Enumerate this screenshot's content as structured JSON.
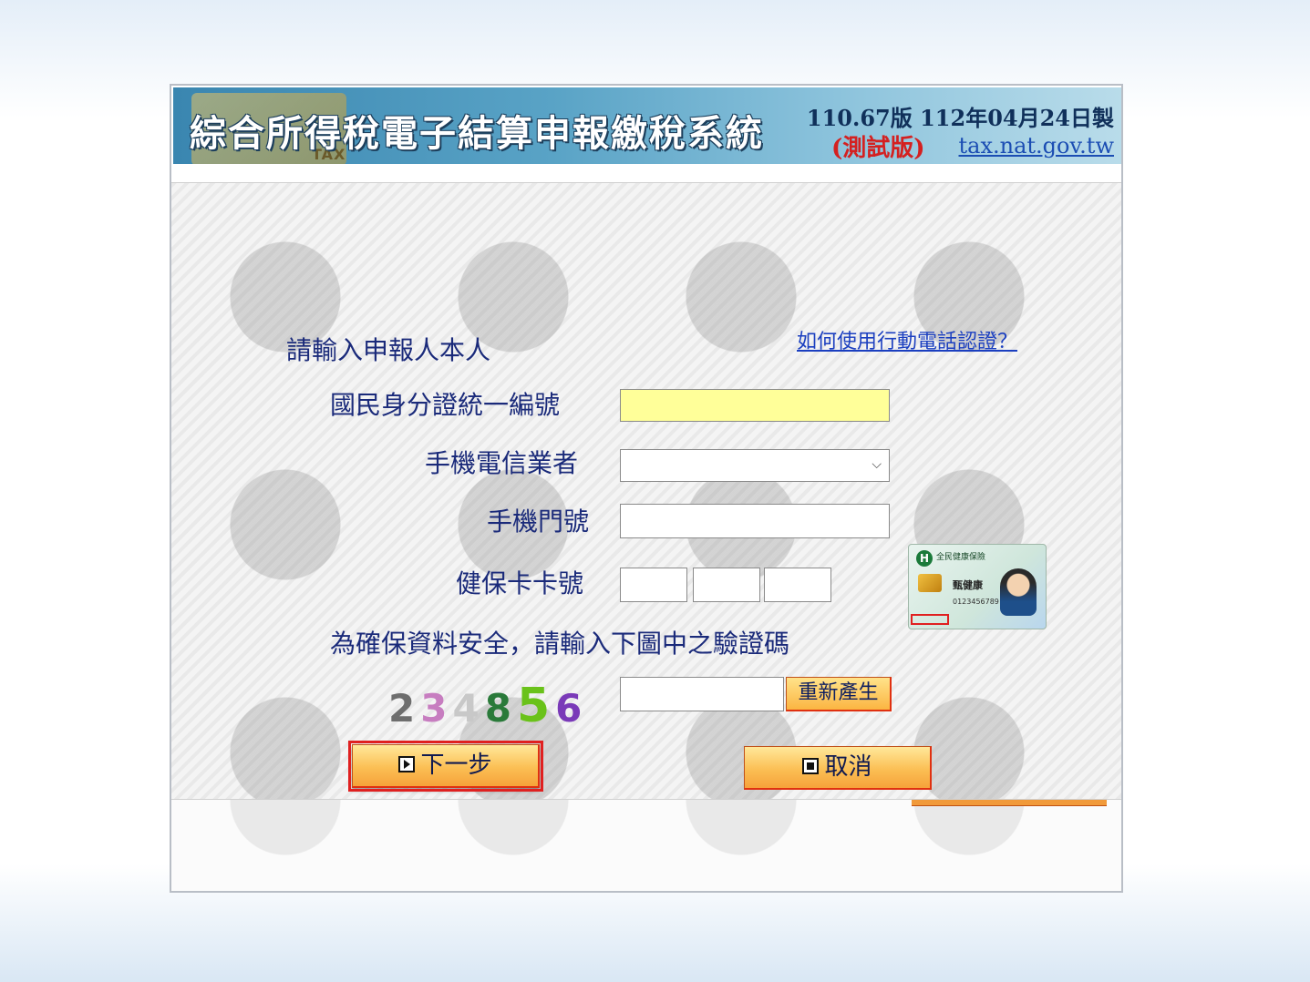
{
  "header": {
    "title": "綜合所得稅電子結算申報繳稅系統",
    "version": "110.67版 112年04月24日製",
    "test_label": "(測試版)",
    "site_link": "tax.nat.gov.tw",
    "tax_tag": "TAX"
  },
  "form": {
    "prompt": "請輸入申報人本人",
    "help_link": "如何使用行動電話認證？",
    "id_label": "國民身分證統一編號",
    "id_value": "",
    "carrier_label": "手機電信業者",
    "carrier_selected": "",
    "phone_label": "手機門號",
    "phone_value": "",
    "nhi_label": "健保卡卡號",
    "nhi_part1": "",
    "nhi_part2": "",
    "nhi_part3": "",
    "captcha_prompt": "為確保資料安全，請輸入下圖中之驗證碼",
    "captcha_digits": [
      "2",
      "3",
      "4",
      "8",
      "5",
      "6"
    ],
    "captcha_colors": [
      "#6e6e6e",
      "#c77dc0",
      "#c8c8c8",
      "#2a7a3a",
      "#6ac21a",
      "#7a3ab8"
    ],
    "captcha_value": "",
    "regen_label": "重新產生"
  },
  "nhi_card": {
    "org": "全民健康保險",
    "name": "甄健康",
    "number": "0123456789"
  },
  "buttons": {
    "next_label": "下一步",
    "cancel_label": "取消"
  }
}
